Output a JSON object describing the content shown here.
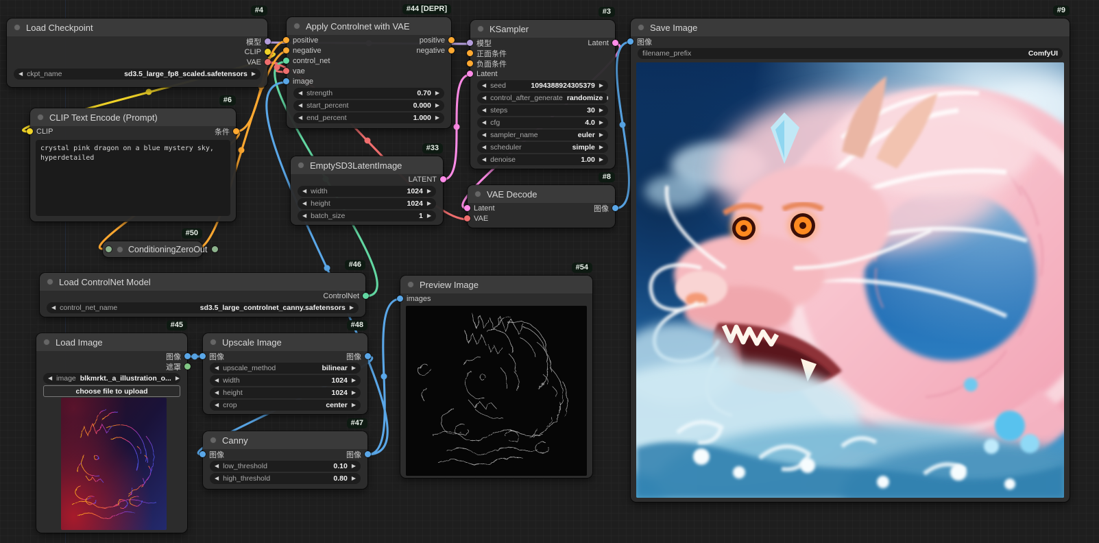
{
  "canvas": {
    "background": "#1e1e1e"
  },
  "colors": {
    "model": "#b39ddb",
    "clip": "#f0d328",
    "vae": "#f06e6e",
    "conditioning": "#ffa931",
    "controlnet": "#62d7a2",
    "image": "#5aa7e8",
    "latent": "#ff8ce8",
    "mask": "#81c784",
    "collapsed": "#8db38d"
  },
  "icons": {
    "stepper_left": "◀",
    "stepper_right": "▶"
  },
  "nodes": {
    "load_checkpoint": {
      "id": "#4",
      "title": "Load Checkpoint",
      "outputs": {
        "model": "模型",
        "clip": "CLIP",
        "vae": "VAE"
      },
      "widgets": {
        "ckpt_name": {
          "label": "ckpt_name",
          "value": "sd3.5_large_fp8_scaled.safetensors"
        }
      }
    },
    "clip_text_encode": {
      "id": "#6",
      "title": "CLIP Text Encode (Prompt)",
      "inputs": {
        "clip": "CLIP"
      },
      "outputs": {
        "conditioning": "条件"
      },
      "prompt": "crystal pink dragon on a blue mystery sky, hyperdetailed"
    },
    "conditioning_zero_out": {
      "id": "#50",
      "title": "ConditioningZeroOut"
    },
    "apply_controlnet": {
      "id": "#44 [DEPR]",
      "title": "Apply Controlnet with VAE",
      "inputs": {
        "positive": "positive",
        "negative": "negative",
        "control_net": "control_net",
        "vae": "vae",
        "image": "image"
      },
      "outputs": {
        "positive": "positive",
        "negative": "negative"
      },
      "widgets": {
        "strength": {
          "label": "strength",
          "value": "0.70"
        },
        "start_percent": {
          "label": "start_percent",
          "value": "0.000"
        },
        "end_percent": {
          "label": "end_percent",
          "value": "1.000"
        }
      }
    },
    "ksampler": {
      "id": "#3",
      "title": "KSampler",
      "inputs": {
        "model": "模型",
        "positive": "正面条件",
        "negative": "负面条件",
        "latent": "Latent"
      },
      "outputs": {
        "latent": "Latent"
      },
      "widgets": {
        "seed": {
          "label": "seed",
          "value": "1094388924305379"
        },
        "control_after_generate": {
          "label": "control_after_generate",
          "value": "randomize"
        },
        "steps": {
          "label": "steps",
          "value": "30"
        },
        "cfg": {
          "label": "cfg",
          "value": "4.0"
        },
        "sampler_name": {
          "label": "sampler_name",
          "value": "euler"
        },
        "scheduler": {
          "label": "scheduler",
          "value": "simple"
        },
        "denoise": {
          "label": "denoise",
          "value": "1.00"
        }
      }
    },
    "empty_sd3_latent": {
      "id": "#33",
      "title": "EmptySD3LatentImage",
      "outputs": {
        "latent": "LATENT"
      },
      "widgets": {
        "width": {
          "label": "width",
          "value": "1024"
        },
        "height": {
          "label": "height",
          "value": "1024"
        },
        "batch_size": {
          "label": "batch_size",
          "value": "1"
        }
      }
    },
    "vae_decode": {
      "id": "#8",
      "title": "VAE Decode",
      "inputs": {
        "latent": "Latent",
        "vae": "VAE"
      },
      "outputs": {
        "image": "图像"
      }
    },
    "save_image": {
      "id": "#9",
      "title": "Save Image",
      "inputs": {
        "image": "图像"
      },
      "widgets": {
        "filename_prefix": {
          "label": "filename_prefix",
          "value": "ComfyUI"
        }
      }
    },
    "load_controlnet": {
      "id": "#46",
      "title": "Load ControlNet Model",
      "outputs": {
        "control_net": "ControlNet"
      },
      "widgets": {
        "control_net_name": {
          "label": "control_net_name",
          "value": "sd3.5_large_controlnet_canny.safetensors"
        }
      }
    },
    "load_image": {
      "id": "#45",
      "title": "Load Image",
      "outputs": {
        "image": "图像",
        "mask": "遮罩"
      },
      "widgets": {
        "image": {
          "label": "image",
          "value": "blkmrkt._a_illustration_o..."
        },
        "upload": {
          "label": "choose file to upload"
        }
      }
    },
    "upscale_image": {
      "id": "#48",
      "title": "Upscale Image",
      "inputs": {
        "image": "图像"
      },
      "outputs": {
        "image": "图像"
      },
      "widgets": {
        "upscale_method": {
          "label": "upscale_method",
          "value": "bilinear"
        },
        "width": {
          "label": "width",
          "value": "1024"
        },
        "height": {
          "label": "height",
          "value": "1024"
        },
        "crop": {
          "label": "crop",
          "value": "center"
        }
      }
    },
    "canny": {
      "id": "#47",
      "title": "Canny",
      "inputs": {
        "image": "图像"
      },
      "outputs": {
        "image": "图像"
      },
      "widgets": {
        "low_threshold": {
          "label": "low_threshold",
          "value": "0.10"
        },
        "high_threshold": {
          "label": "high_threshold",
          "value": "0.80"
        }
      }
    },
    "preview_image": {
      "id": "#54",
      "title": "Preview Image",
      "inputs": {
        "images": "images"
      }
    }
  }
}
